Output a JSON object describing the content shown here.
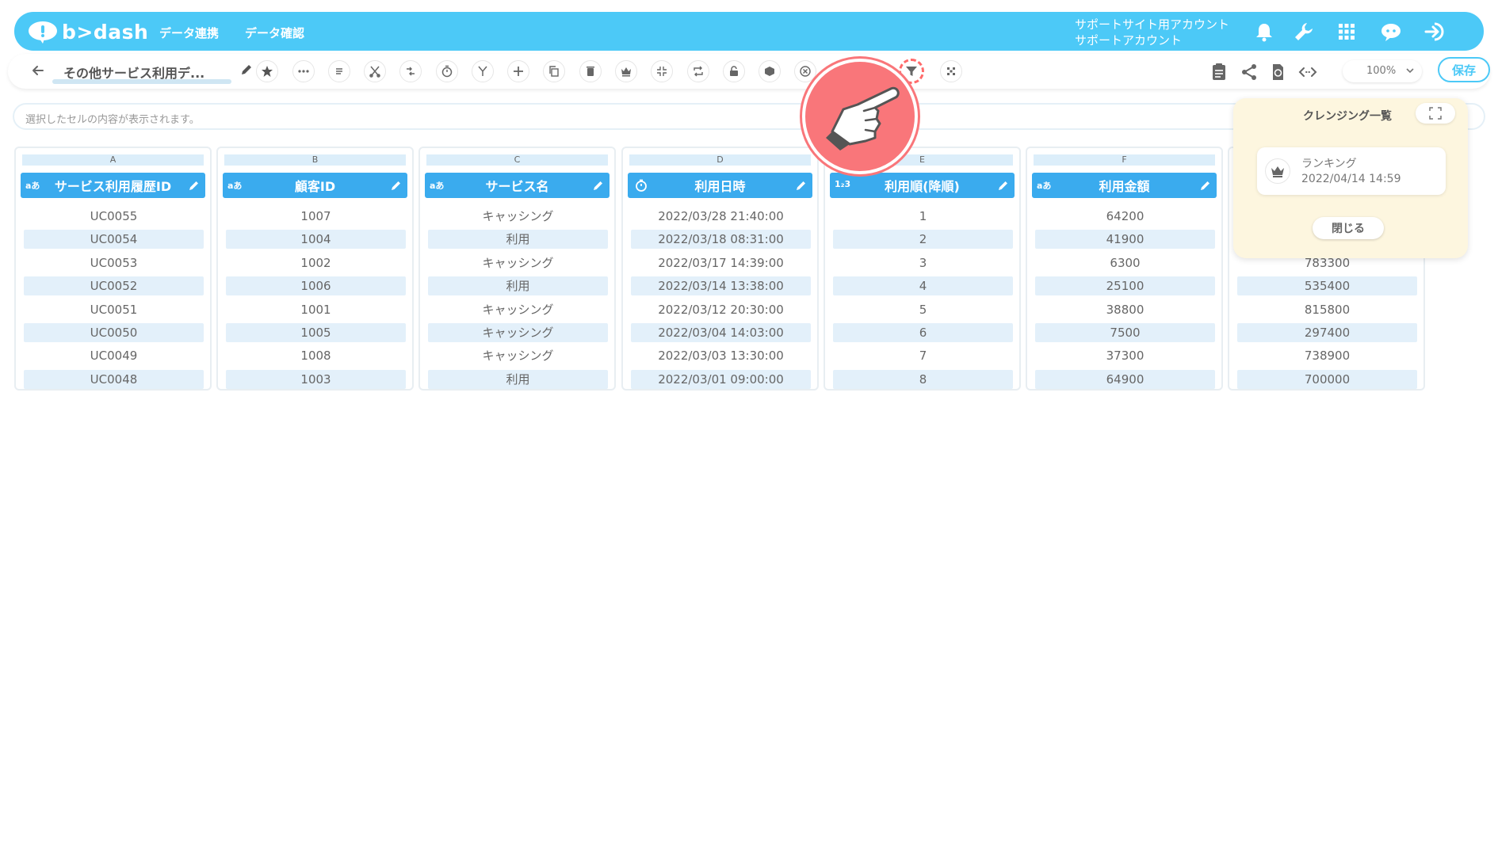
{
  "header": {
    "logo": "b>dash",
    "nav": [
      "データ連携",
      "データ確認"
    ],
    "account_line1": "サポートサイト用アカウント",
    "account_line2": "サポートアカウント",
    "accent_color": "#4cc9f7"
  },
  "toolbar": {
    "title": "その他サービス利用デ...",
    "zoom": "100%",
    "save_label": "保存"
  },
  "cellbar": {
    "text": "選択したセルの内容が表示されます。"
  },
  "columns": [
    {
      "letter": "A",
      "type": "aあ",
      "name": "サービス利用履歴ID",
      "values": [
        "UC0055",
        "UC0054",
        "UC0053",
        "UC0052",
        "UC0051",
        "UC0050",
        "UC0049",
        "UC0048"
      ]
    },
    {
      "letter": "B",
      "type": "aあ",
      "name": "顧客ID",
      "values": [
        "1007",
        "1004",
        "1002",
        "1006",
        "1001",
        "1005",
        "1008",
        "1003"
      ]
    },
    {
      "letter": "C",
      "type": "aあ",
      "name": "サービス名",
      "values": [
        "キャッシング",
        "利用",
        "キャッシング",
        "利用",
        "キャッシング",
        "キャッシング",
        "キャッシング",
        "利用"
      ]
    },
    {
      "letter": "D",
      "type": "clock",
      "name": "利用日時",
      "values": [
        "2022/03/28 21:40:00",
        "2022/03/18 08:31:00",
        "2022/03/17 14:39:00",
        "2022/03/14 13:38:00",
        "2022/03/12 20:30:00",
        "2022/03/04 14:03:00",
        "2022/03/03 13:30:00",
        "2022/03/01 09:00:00"
      ]
    },
    {
      "letter": "E",
      "type": "1₂3",
      "name": "利用順(降順)",
      "values": [
        "1",
        "2",
        "3",
        "4",
        "5",
        "6",
        "7",
        "8"
      ]
    },
    {
      "letter": "F",
      "type": "aあ",
      "name": "利用金額",
      "values": [
        "64200",
        "41900",
        "6300",
        "25100",
        "38800",
        "7500",
        "37300",
        "64900"
      ]
    },
    {
      "letter": "",
      "type": "",
      "name": "",
      "values": [
        "",
        "",
        "783300",
        "535400",
        "815800",
        "297400",
        "738900",
        "700000"
      ]
    }
  ],
  "panel": {
    "title": "クレンジング一覧",
    "item_name": "ランキング",
    "item_date": "2022/04/14 14:59",
    "close_label": "閉じる"
  }
}
